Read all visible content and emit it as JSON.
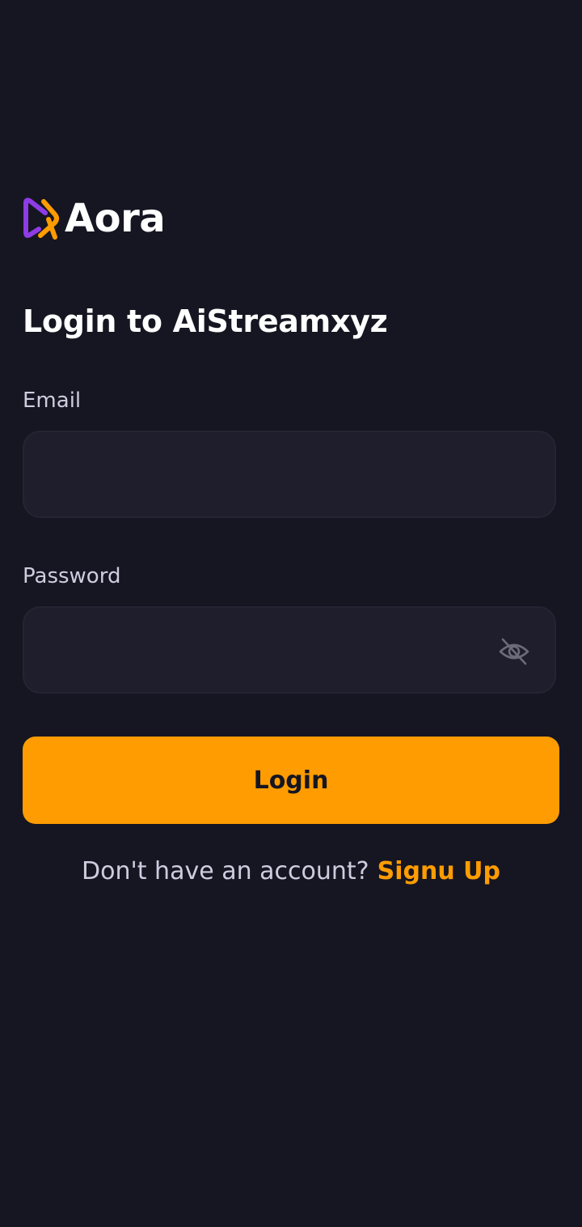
{
  "app": {
    "logo_text": "Aora",
    "logo_icon": "play-bracket-logo-icon"
  },
  "page": {
    "title": "Login to AiStreamxyz"
  },
  "form": {
    "email": {
      "label": "Email",
      "value": "",
      "placeholder": ""
    },
    "password": {
      "label": "Password",
      "value": "",
      "placeholder": "",
      "toggle_icon": "eye-off-icon"
    },
    "submit_label": "Login"
  },
  "footer": {
    "prompt": "Don't have an account?",
    "link_label": "Signu Up"
  },
  "colors": {
    "background": "#161622",
    "field_background": "#1E1E2D",
    "field_border": "#232533",
    "accent": "#FF9C01",
    "label": "#CDCDE0",
    "logo_purple": "#8E3CE6",
    "logo_orange": "#FF9C01"
  }
}
